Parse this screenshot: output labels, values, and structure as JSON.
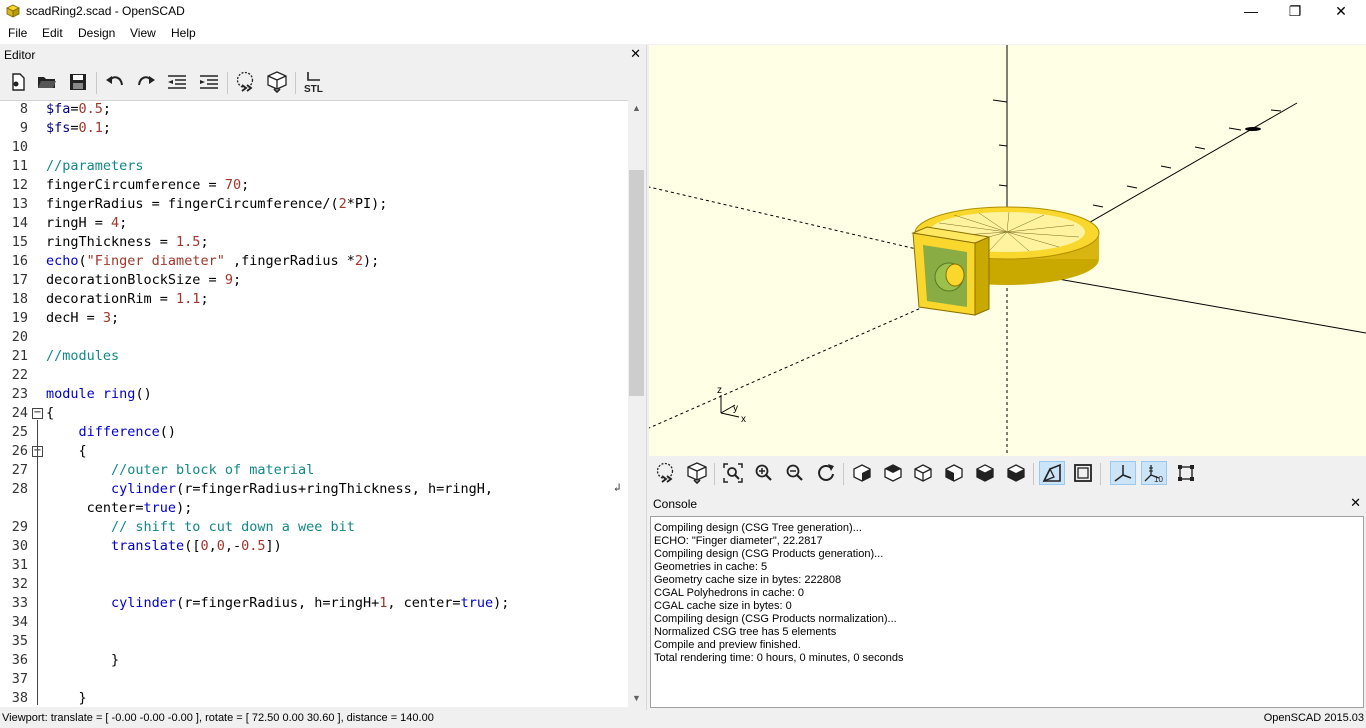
{
  "window": {
    "title": "scadRing2.scad - OpenSCAD",
    "minimize": "—",
    "maximize": "❐",
    "close": "✕"
  },
  "menu": {
    "items": [
      "File",
      "Edit",
      "Design",
      "View",
      "Help"
    ]
  },
  "editor": {
    "title": "Editor",
    "close": "✕",
    "toolbar": [
      "new-file",
      "open-file",
      "save-file",
      "undo",
      "redo",
      "unindent",
      "indent",
      "preview",
      "render",
      "export-stl"
    ],
    "stl_label": "STL",
    "lines": [
      {
        "n": "8",
        "parts": [
          [
            "var",
            "$fa"
          ],
          [
            "id",
            "="
          ],
          [
            "num",
            "0.5"
          ],
          [
            "id",
            ";"
          ]
        ]
      },
      {
        "n": "9",
        "parts": [
          [
            "var",
            "$fs"
          ],
          [
            "id",
            "="
          ],
          [
            "num",
            "0.1"
          ],
          [
            "id",
            ";"
          ]
        ]
      },
      {
        "n": "10",
        "parts": []
      },
      {
        "n": "11",
        "parts": [
          [
            "cm",
            "//parameters"
          ]
        ]
      },
      {
        "n": "12",
        "parts": [
          [
            "id",
            "fingerCircumference = "
          ],
          [
            "num",
            "70"
          ],
          [
            "id",
            ";"
          ]
        ]
      },
      {
        "n": "13",
        "parts": [
          [
            "id",
            "fingerRadius = fingerCircumference/("
          ],
          [
            "num",
            "2"
          ],
          [
            "id",
            "*PI);"
          ]
        ]
      },
      {
        "n": "14",
        "parts": [
          [
            "id",
            "ringH = "
          ],
          [
            "num",
            "4"
          ],
          [
            "id",
            ";"
          ]
        ]
      },
      {
        "n": "15",
        "parts": [
          [
            "id",
            "ringThickness = "
          ],
          [
            "num",
            "1.5"
          ],
          [
            "id",
            ";"
          ]
        ]
      },
      {
        "n": "16",
        "parts": [
          [
            "fn",
            "echo"
          ],
          [
            "id",
            "("
          ],
          [
            "str",
            "\"Finger diameter\""
          ],
          [
            "id",
            " ,fingerRadius *"
          ],
          [
            "num",
            "2"
          ],
          [
            "id",
            ");"
          ]
        ]
      },
      {
        "n": "17",
        "parts": [
          [
            "id",
            "decorationBlockSize = "
          ],
          [
            "num",
            "9"
          ],
          [
            "id",
            ";"
          ]
        ]
      },
      {
        "n": "18",
        "parts": [
          [
            "id",
            "decorationRim = "
          ],
          [
            "num",
            "1.1"
          ],
          [
            "id",
            ";"
          ]
        ]
      },
      {
        "n": "19",
        "parts": [
          [
            "id",
            "decH = "
          ],
          [
            "num",
            "3"
          ],
          [
            "id",
            ";"
          ]
        ]
      },
      {
        "n": "20",
        "parts": []
      },
      {
        "n": "21",
        "parts": [
          [
            "cm",
            "//modules"
          ]
        ]
      },
      {
        "n": "22",
        "parts": []
      },
      {
        "n": "23",
        "parts": [
          [
            "kw",
            "module"
          ],
          [
            "id",
            " "
          ],
          [
            "fn",
            "ring"
          ],
          [
            "id",
            "()"
          ]
        ]
      },
      {
        "n": "24",
        "parts": [
          [
            "id",
            "{"
          ]
        ],
        "fold": true
      },
      {
        "n": "25",
        "parts": [
          [
            "id",
            "    "
          ],
          [
            "kw",
            "difference"
          ],
          [
            "id",
            "()"
          ]
        ]
      },
      {
        "n": "26",
        "parts": [
          [
            "id",
            "    {"
          ]
        ],
        "fold": true
      },
      {
        "n": "27",
        "parts": [
          [
            "id",
            "        "
          ],
          [
            "cm",
            "//outer block of material"
          ]
        ]
      },
      {
        "n": "28",
        "parts": [
          [
            "id",
            "        "
          ],
          [
            "fn",
            "cylinder"
          ],
          [
            "id",
            "(r=fingerRadius+ringThickness, h=ringH,"
          ]
        ],
        "wrap": true
      },
      {
        "n": "",
        "parts": [
          [
            "id",
            "     center="
          ],
          [
            "kw",
            "true"
          ],
          [
            "id",
            ");"
          ]
        ]
      },
      {
        "n": "29",
        "parts": [
          [
            "id",
            "        "
          ],
          [
            "cm",
            "// shift to cut down a wee bit"
          ]
        ]
      },
      {
        "n": "30",
        "parts": [
          [
            "id",
            "        "
          ],
          [
            "fn",
            "translate"
          ],
          [
            "id",
            "(["
          ],
          [
            "num",
            "0"
          ],
          [
            "id",
            ","
          ],
          [
            "num",
            "0"
          ],
          [
            "id",
            ",-"
          ],
          [
            "num",
            "0.5"
          ],
          [
            "id",
            "])"
          ]
        ]
      },
      {
        "n": "31",
        "parts": []
      },
      {
        "n": "32",
        "parts": []
      },
      {
        "n": "33",
        "parts": [
          [
            "id",
            "        "
          ],
          [
            "fn",
            "cylinder"
          ],
          [
            "id",
            "(r=fingerRadius, h=ringH+"
          ],
          [
            "num",
            "1"
          ],
          [
            "id",
            ", center="
          ],
          [
            "kw",
            "true"
          ],
          [
            "id",
            ");"
          ]
        ]
      },
      {
        "n": "34",
        "parts": []
      },
      {
        "n": "35",
        "parts": []
      },
      {
        "n": "36",
        "parts": [
          [
            "id",
            "        }"
          ]
        ]
      },
      {
        "n": "37",
        "parts": []
      },
      {
        "n": "38",
        "parts": [
          [
            "id",
            "    }"
          ]
        ]
      }
    ]
  },
  "viewport_toolbar": [
    "preview",
    "render",
    "view-all",
    "zoom-in",
    "zoom-out",
    "reset-view",
    "view-right",
    "view-top",
    "view-bottom",
    "view-left",
    "view-front",
    "view-back",
    "perspective",
    "orthogonal",
    "show-axes",
    "show-scale-markers",
    "show-edges"
  ],
  "axes_labels": {
    "z": "z",
    "y": "y",
    "x": "x"
  },
  "scale_label": "10",
  "console": {
    "title": "Console",
    "close": "✕",
    "lines": [
      "Compiling design (CSG Tree generation)...",
      "ECHO: \"Finger diameter\", 22.2817",
      "Compiling design (CSG Products generation)...",
      "Geometries in cache: 5",
      "Geometry cache size in bytes: 222808",
      "CGAL Polyhedrons in cache: 0",
      "CGAL cache size in bytes: 0",
      "Compiling design (CSG Products normalization)...",
      "Normalized CSG tree has 5 elements",
      "Compile and preview finished.",
      "Total rendering time: 0 hours, 0 minutes, 0 seconds"
    ]
  },
  "status": {
    "viewport": "Viewport: translate = [ -0.00 -0.00 -0.00 ], rotate = [ 72.50 0.00 30.60 ], distance = 140.00",
    "version": "OpenSCAD 2015.03"
  },
  "colors": {
    "viewport_bg": "#ffffe5",
    "model": "#f9d72c",
    "model_dark": "#c9a800",
    "inner": "#8aac44"
  }
}
